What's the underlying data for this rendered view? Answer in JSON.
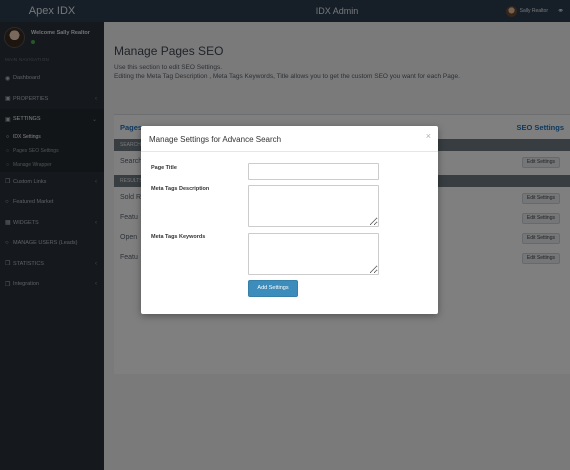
{
  "app": {
    "brand": "Apex IDX",
    "title": "IDX Admin",
    "user_name": "Sally Realtor"
  },
  "sidebar": {
    "welcome": "Welcome Sally Realtor",
    "nav_header": "MAIN NAVIGATION",
    "items": [
      {
        "label": "Dashboard",
        "icon": "dashboard-icon"
      },
      {
        "label": "PROPERTIES",
        "icon": "laptop-icon"
      },
      {
        "label": "SETTINGS",
        "icon": "laptop-icon"
      },
      {
        "label": "Custom Links",
        "icon": "files-icon"
      },
      {
        "label": "Featured Market",
        "icon": "circle-icon"
      },
      {
        "label": "WIDGETS",
        "icon": "th-icon"
      },
      {
        "label": "MANAGE USERS (Leads)",
        "icon": "circle-icon"
      },
      {
        "label": "STATISTICS",
        "icon": "files-icon"
      },
      {
        "label": "Integration",
        "icon": "files-icon"
      }
    ],
    "settings_sub": [
      {
        "label": "IDX Settings"
      },
      {
        "label": "Pages SEO Settings"
      },
      {
        "label": "Manage Wrapper"
      }
    ]
  },
  "main": {
    "title": "Manage Pages SEO",
    "desc_line1": "Use this section to edit SEO Settings.",
    "desc_line2": "Editing the Meta Tag Description , Meta Tags Keywords, Title allows you to get the custom SEO you want for each Page.",
    "table": {
      "col_pages": "Pages",
      "col_seo": "SEO Settings",
      "group1": "SEARCH",
      "group2": "RESULTS",
      "rows": [
        {
          "label": "Search"
        },
        {
          "label": "Sold R"
        },
        {
          "label": "Featu"
        },
        {
          "label": "Open"
        },
        {
          "label": "Featu"
        }
      ],
      "edit_label": "Edit Settings"
    }
  },
  "modal": {
    "title": "Manage Settings for Advance Search",
    "close": "×",
    "page_title_label": "Page Title",
    "page_title_value": "",
    "desc_label": "Meta Tags Description",
    "desc_value": "",
    "keywords_label": "Meta Tags Keywords",
    "keywords_value": "",
    "submit_label": "Add Settings"
  },
  "colors": {
    "topbar": "#2d3d4f",
    "sidebar": "#2b323a",
    "link_blue": "#1e73be",
    "primary_button": "#3c8dbc"
  }
}
